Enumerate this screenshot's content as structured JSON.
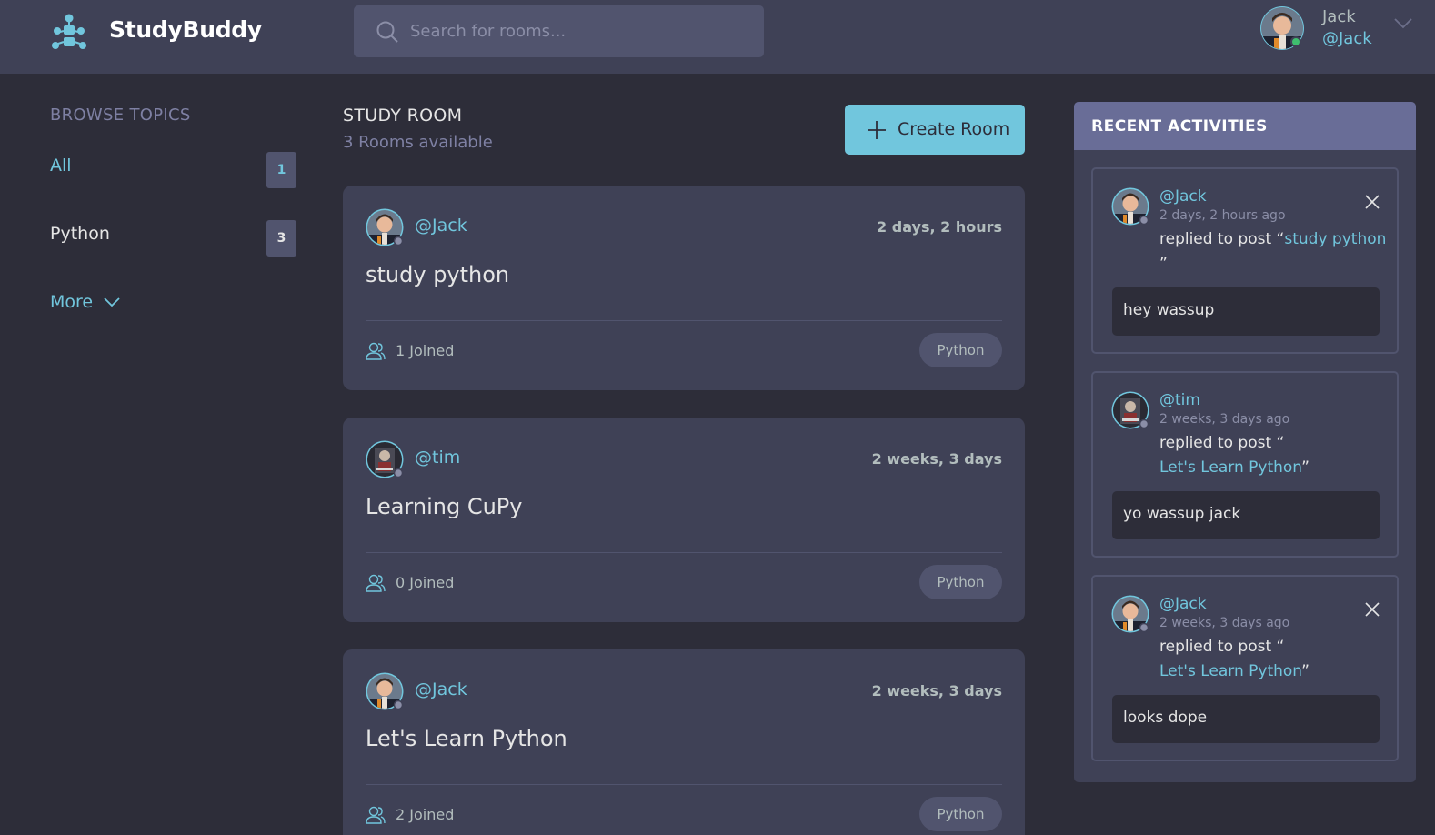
{
  "header": {
    "brand": "StudyBuddy",
    "search_placeholder": "Search for rooms...",
    "user": {
      "name": "Jack",
      "handle": "@Jack"
    }
  },
  "sidebar": {
    "title": "BROWSE TOPICS",
    "topics": [
      {
        "label": "All",
        "count": "1"
      },
      {
        "label": "Python",
        "count": "3"
      }
    ],
    "more_label": "More"
  },
  "main": {
    "title": "STUDY ROOM",
    "rooms_available": "3 Rooms available",
    "create_label": "Create Room",
    "rooms": [
      {
        "host": "@Jack",
        "time": "2 days, 2 hours",
        "title": "study python",
        "joined": "1 Joined",
        "topic": "Python"
      },
      {
        "host": "@tim",
        "time": "2 weeks, 3 days",
        "title": "Learning CuPy",
        "joined": "0 Joined",
        "topic": "Python"
      },
      {
        "host": "@Jack",
        "time": "2 weeks, 3 days",
        "title": "Let's Learn Python",
        "joined": "2 Joined",
        "topic": "Python"
      }
    ]
  },
  "activities": {
    "title": "RECENT ACTIVITIES",
    "items": [
      {
        "user": "@Jack",
        "time": "2 days, 2 hours ago",
        "action": "replied to post “",
        "post": "study python",
        "action_end": "”",
        "message": "hey wassup"
      },
      {
        "user": "@tim",
        "time": "2 weeks, 3 days ago",
        "action": "replied to post “",
        "post": "Let's Learn Python",
        "action_end": "”",
        "message": "yo wassup jack"
      },
      {
        "user": "@Jack",
        "time": "2 weeks, 3 days ago",
        "action": "replied to post “",
        "post": "Let's Learn Python",
        "action_end": "”",
        "message": "looks dope"
      }
    ]
  },
  "colors": {
    "background": "#2d2d39",
    "header": "#3f4156",
    "accent": "#71c6dd",
    "muted": "#7e80a3",
    "card": "#3f4156",
    "activity_header": "#696d97"
  },
  "icons": [
    "logo-icon",
    "search-icon",
    "chevron-down-icon",
    "plus-icon",
    "users-icon",
    "close-icon"
  ]
}
